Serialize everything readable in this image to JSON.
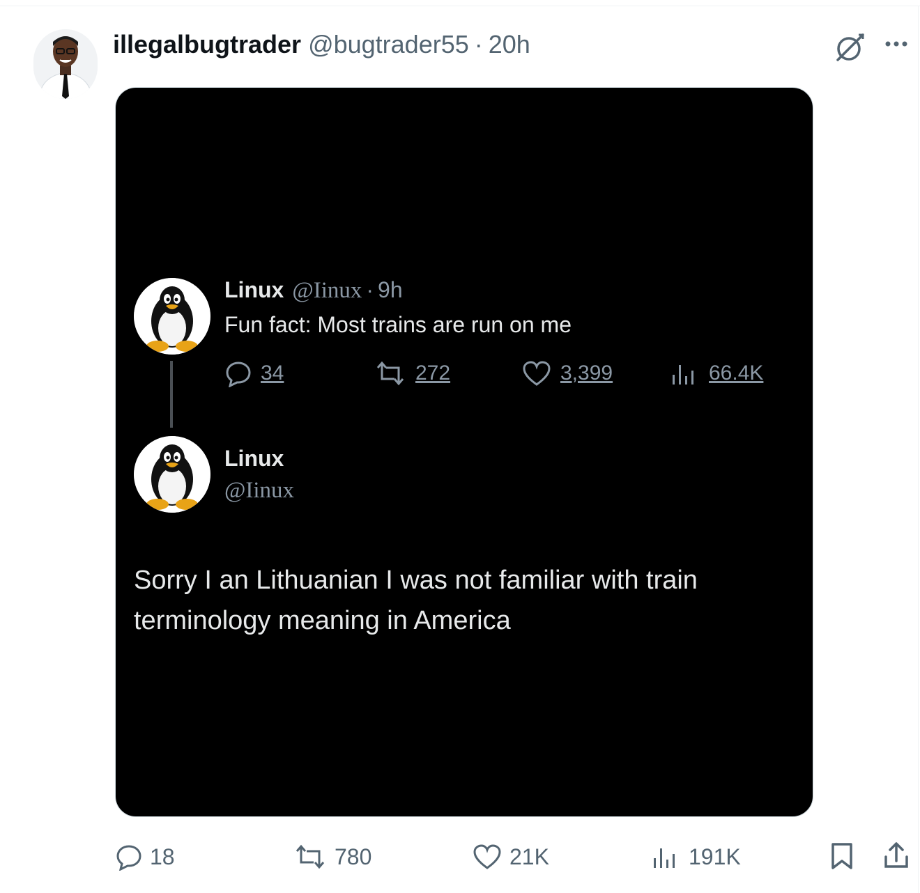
{
  "post": {
    "author": {
      "display_name": "illegalbugtrader",
      "handle": "@bugtrader55",
      "separator": "·",
      "time": "20h"
    },
    "header_icons": [
      "grok-icon",
      "more-icon"
    ],
    "media": {
      "quoted_tweet": {
        "name": "Linux",
        "handle": "@Iinux",
        "separator": "·",
        "time": "9h",
        "text": "Fun fact: Most trains are run on me",
        "stats": {
          "replies": "34",
          "reposts": "272",
          "likes": "3,399",
          "views": "66.4K"
        }
      },
      "reply": {
        "name": "Linux",
        "handle": "@Iinux",
        "text": "Sorry I an Lithuanian I was not familiar with train terminology meaning in America"
      }
    },
    "actions": {
      "replies": "18",
      "reposts": "780",
      "likes": "21K",
      "views": "191K"
    }
  },
  "colors": {
    "text": "#0f1419",
    "secondary": "#536471",
    "media_bg": "#000000",
    "media_text": "#e7e9ea",
    "media_secondary": "#8b98a5"
  }
}
